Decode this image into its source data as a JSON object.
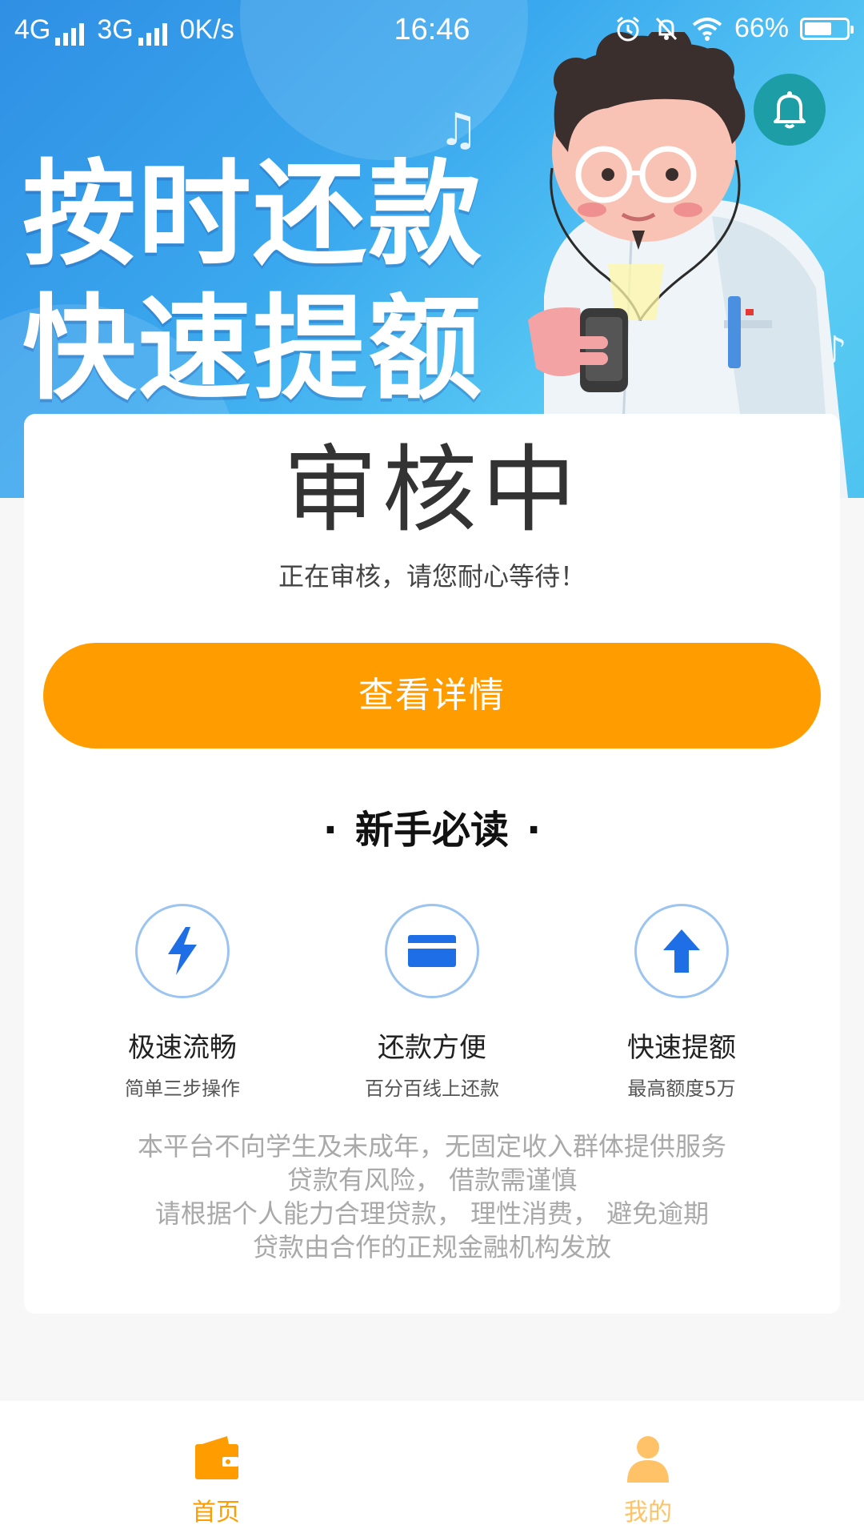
{
  "status_bar": {
    "network_1": "4G",
    "network_2": "3G",
    "speed": "0K/s",
    "time": "16:46",
    "battery": "66%",
    "battery_level": 0.66
  },
  "banner": {
    "slogan_line1": "按时还款",
    "slogan_line2": "快速提额",
    "bell_icon": "bell-icon"
  },
  "review": {
    "title": "审核中",
    "subtitle": "正在审核，请您耐心等待！",
    "detail_button": "查看详情"
  },
  "guide": {
    "dot": "·",
    "title": "新手必读",
    "features": [
      {
        "icon": "lightning-icon",
        "title": "极速流畅",
        "subtitle": "简单三步操作"
      },
      {
        "icon": "card-icon",
        "title": "还款方便",
        "subtitle": "百分百线上还款"
      },
      {
        "icon": "arrow-up-icon",
        "title": "快速提额",
        "subtitle": "最高额度5万"
      }
    ]
  },
  "notice": {
    "lines": [
      "本平台不向学生及未成年，无固定收入群体提供服务",
      "贷款有风险， 借款需谨慎",
      "请根据个人能力合理贷款， 理性消费， 避免逾期",
      "贷款由合作的正规金融机构发放"
    ]
  },
  "bottom_nav": {
    "items": [
      {
        "label": "首页",
        "icon": "wallet-icon",
        "active": true
      },
      {
        "label": "我的",
        "icon": "user-icon",
        "active": false
      }
    ]
  },
  "colors": {
    "accent": "#ff9d00",
    "accent_light": "#ffc266",
    "icon_blue": "#1e6fe6",
    "icon_ring": "#9cc4f0",
    "bell_bg": "#1d9ea7"
  }
}
